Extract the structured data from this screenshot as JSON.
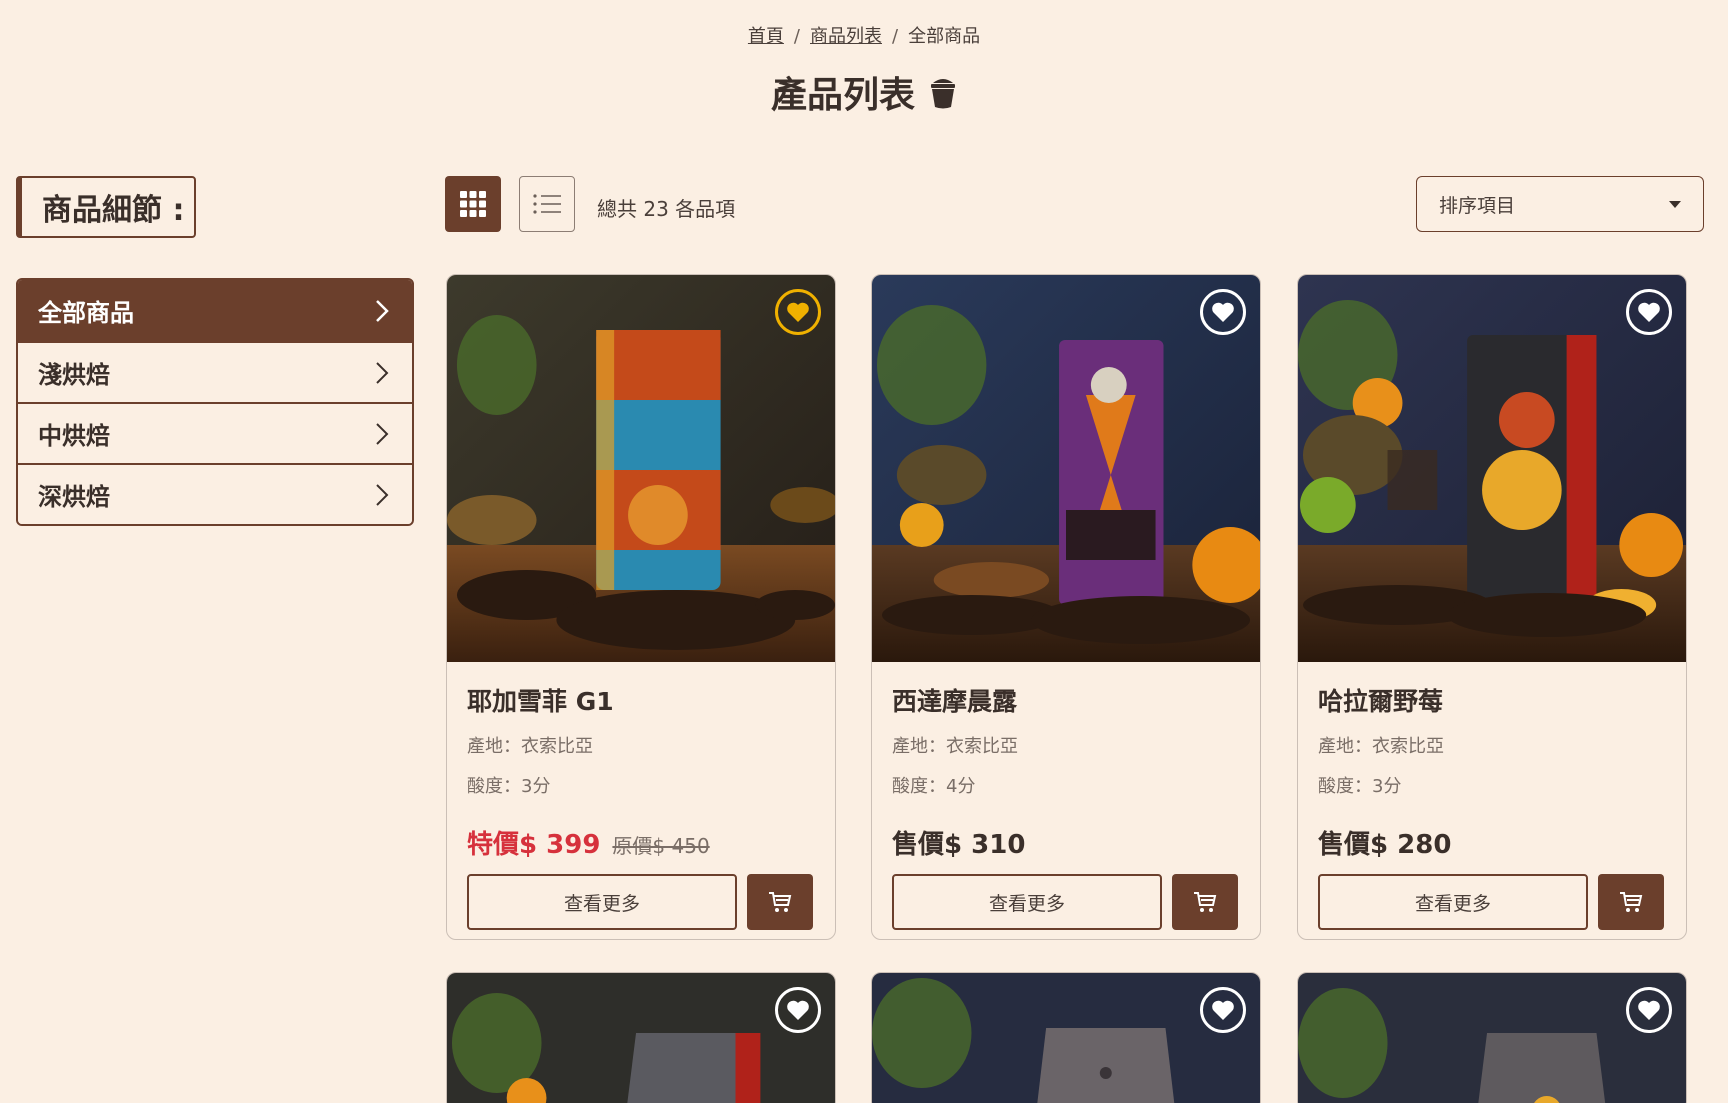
{
  "breadcrumb": {
    "home": "首頁",
    "list": "商品列表",
    "current": "全部商品",
    "separator": "/"
  },
  "page_title": "產品列表",
  "sidebar": {
    "heading": "商品細節 :",
    "items": [
      {
        "label": "全部商品",
        "active": true
      },
      {
        "label": "淺烘焙",
        "active": false
      },
      {
        "label": "中烘焙",
        "active": false
      },
      {
        "label": "深烘焙",
        "active": false
      }
    ]
  },
  "toolbar": {
    "grid_view_icon": "grid-icon",
    "list_view_icon": "list-icon",
    "count_text": "總共 23 各品項",
    "sort_placeholder": "排序項目"
  },
  "products": [
    {
      "name": "耶加雪菲 G1",
      "origin": "產地：衣索比亞",
      "acidity": "酸度：3分",
      "price": "特價$ 399",
      "original_price": "原價$ 450",
      "on_sale": true,
      "favorited": true,
      "more_label": "查看更多"
    },
    {
      "name": "西達摩晨露",
      "origin": "產地：衣索比亞",
      "acidity": "酸度：4分",
      "price": "售價$ 310",
      "original_price": "",
      "on_sale": false,
      "favorited": false,
      "more_label": "查看更多"
    },
    {
      "name": "哈拉爾野莓",
      "origin": "產地：衣索比亞",
      "acidity": "酸度：3分",
      "price": "售價$ 280",
      "original_price": "",
      "on_sale": false,
      "favorited": false,
      "more_label": "查看更多"
    }
  ],
  "colors": {
    "background": "#fbefe3",
    "brand_brown": "#6b3f2c",
    "sale_red": "#d6313c",
    "favorite_gold": "#f0b100"
  }
}
